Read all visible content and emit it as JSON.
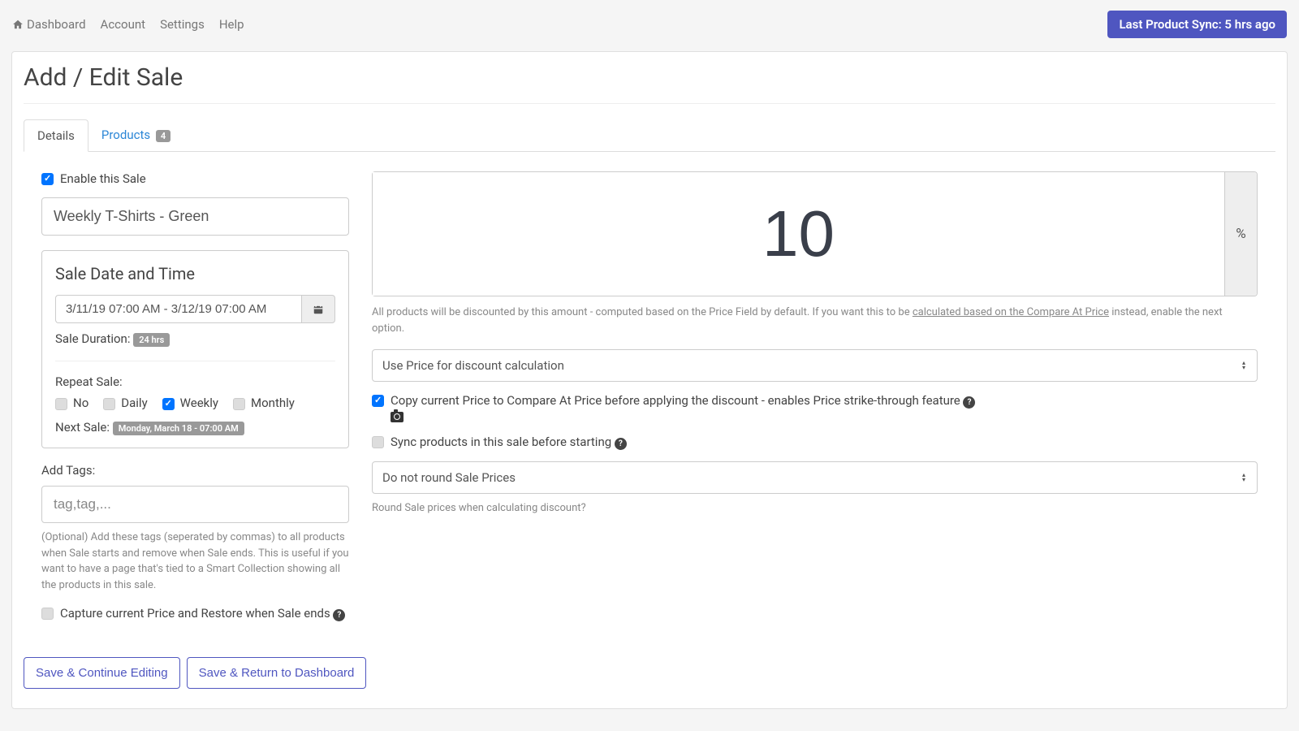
{
  "nav": {
    "dashboard": "Dashboard",
    "account": "Account",
    "settings": "Settings",
    "help": "Help",
    "sync_badge": "Last Product Sync: 5 hrs ago"
  },
  "page_title": "Add / Edit Sale",
  "tabs": {
    "details": "Details",
    "products": "Products",
    "products_count": "4"
  },
  "left": {
    "enable_label": "Enable this Sale",
    "sale_name": "Weekly T-Shirts - Green",
    "date_panel_title": "Sale Date and Time",
    "date_range": "3/11/19 07:00 AM - 3/12/19 07:00 AM",
    "duration_label": "Sale Duration: ",
    "duration_value": "24 hrs",
    "repeat_label": "Repeat Sale:",
    "repeat_options": {
      "no": "No",
      "daily": "Daily",
      "weekly": "Weekly",
      "monthly": "Monthly"
    },
    "next_label": "Next Sale: ",
    "next_value": "Monday, March 18 - 07:00 AM",
    "tags_label": "Add Tags:",
    "tags_placeholder": "tag,tag,...",
    "tags_help": "(Optional) Add these tags (seperated by commas) to all products when Sale starts and remove when Sale ends. This is useful if you want to have a page that's tied to a Smart Collection showing all the products in this sale.",
    "capture_label": "Capture current Price and Restore when Sale ends "
  },
  "right": {
    "discount_value": "10",
    "pct": "%",
    "discount_help_pre": "All products will be discounted by this amount - computed based on the Price Field by default. If you want this to be ",
    "discount_help_link": "calculated based on the Compare At Price",
    "discount_help_post": " instead, enable the next option.",
    "price_calc_select": "Use Price for discount calculation",
    "copy_label": "Copy current Price to Compare At Price before applying the discount - enables Price strike-through feature ",
    "sync_label": "Sync products in this sale before starting ",
    "round_select": "Do not round Sale Prices",
    "round_help": "Round Sale prices when calculating discount?"
  },
  "buttons": {
    "save_continue": "Save & Continue Editing",
    "save_return": "Save & Return to Dashboard"
  }
}
